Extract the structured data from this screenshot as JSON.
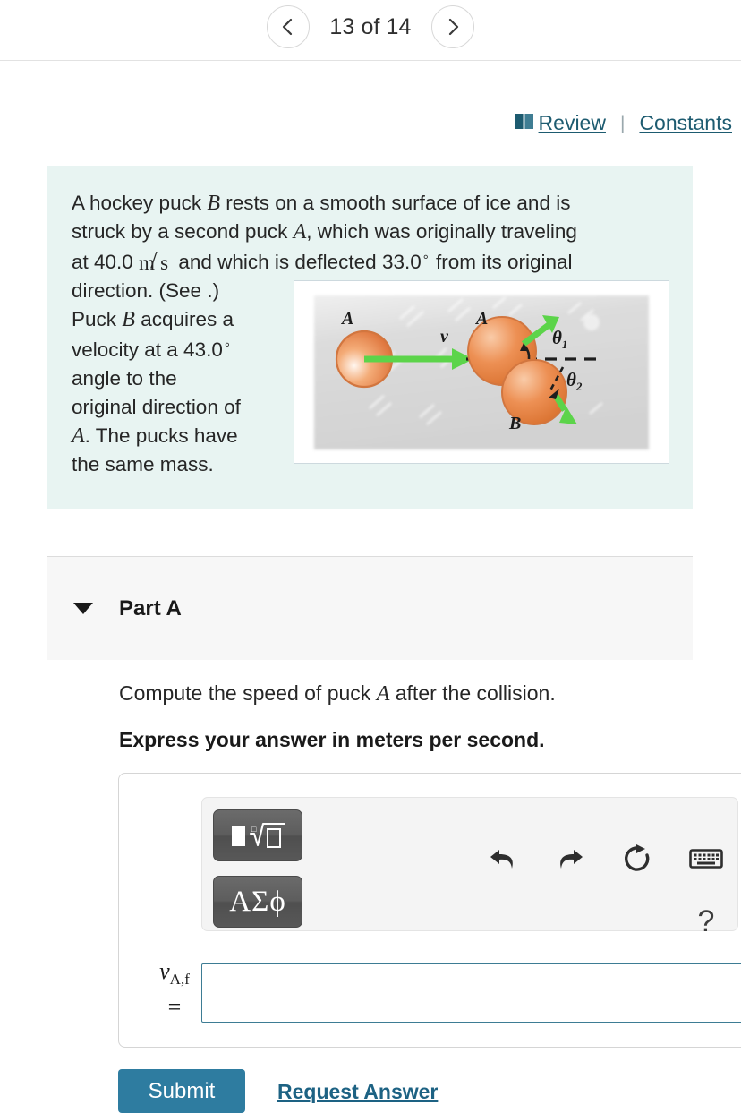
{
  "nav": {
    "prev_icon": "chevron-left-icon",
    "next_icon": "chevron-right-icon",
    "page_label": "13 of 14"
  },
  "reviewbar": {
    "book_icon": "book-icon",
    "review_label": "Review",
    "separator": "|",
    "constants_label": "Constants",
    "link_color": "#1d5b70"
  },
  "problem": {
    "background": "#e8f4f2",
    "line1_a": "A hockey puck ",
    "var_B1": "B",
    "line1_b": " rests on a smooth surface of ice and is",
    "line2_a": "struck by a second puck ",
    "var_A1": "A",
    "line2_b": ", which was originally traveling",
    "line3_a": "at 40.0 ",
    "unit_num": "m",
    "unit_slash": "/",
    "unit_den": "s",
    "line3_b": " and which is deflected 33.0",
    "degree": "°",
    "line3_c": " from its original",
    "line4": "direction. (See .)",
    "line5_a": "Puck ",
    "var_B2": "B",
    "line5_b": " acquires a",
    "line6": "velocity at a 43.0",
    "line7": "angle to the",
    "line8": "original direction of",
    "var_A2": "A",
    "line9": ". The pucks have",
    "line10": "the same mass."
  },
  "figure": {
    "name": "collision-diagram",
    "label_A_left": "A",
    "label_v": "v",
    "label_A_right": "A",
    "label_B": "B",
    "label_theta1": "θ",
    "label_theta1_sub": "1",
    "label_theta2": "θ",
    "label_theta2_sub": "2",
    "puck_color": "#e8834a",
    "arrow_color": "#5cd44a",
    "bg_color": "#d6d6d6"
  },
  "part_a": {
    "caret_icon": "caret-down-icon",
    "title": "Part A",
    "prompt_a": "Compute the speed of puck ",
    "prompt_var": "A",
    "prompt_b": " after the collision.",
    "express": "Express your answer in meters per second."
  },
  "answer": {
    "sqrt_button_icon": "math-template-icon",
    "greek_button_label": "ΑΣϕ",
    "undo_icon": "undo-icon",
    "redo_icon": "redo-icon",
    "reset_icon": "reset-icon",
    "keyboard_icon": "keyboard-icon",
    "help_icon": "?",
    "variable": "v",
    "variable_sub": "A,f",
    "equals": "=",
    "value": "",
    "placeholder": ""
  },
  "footer": {
    "submit_label": "Submit",
    "request_answer_label": "Request Answer",
    "submit_color": "#2e7ca0"
  }
}
